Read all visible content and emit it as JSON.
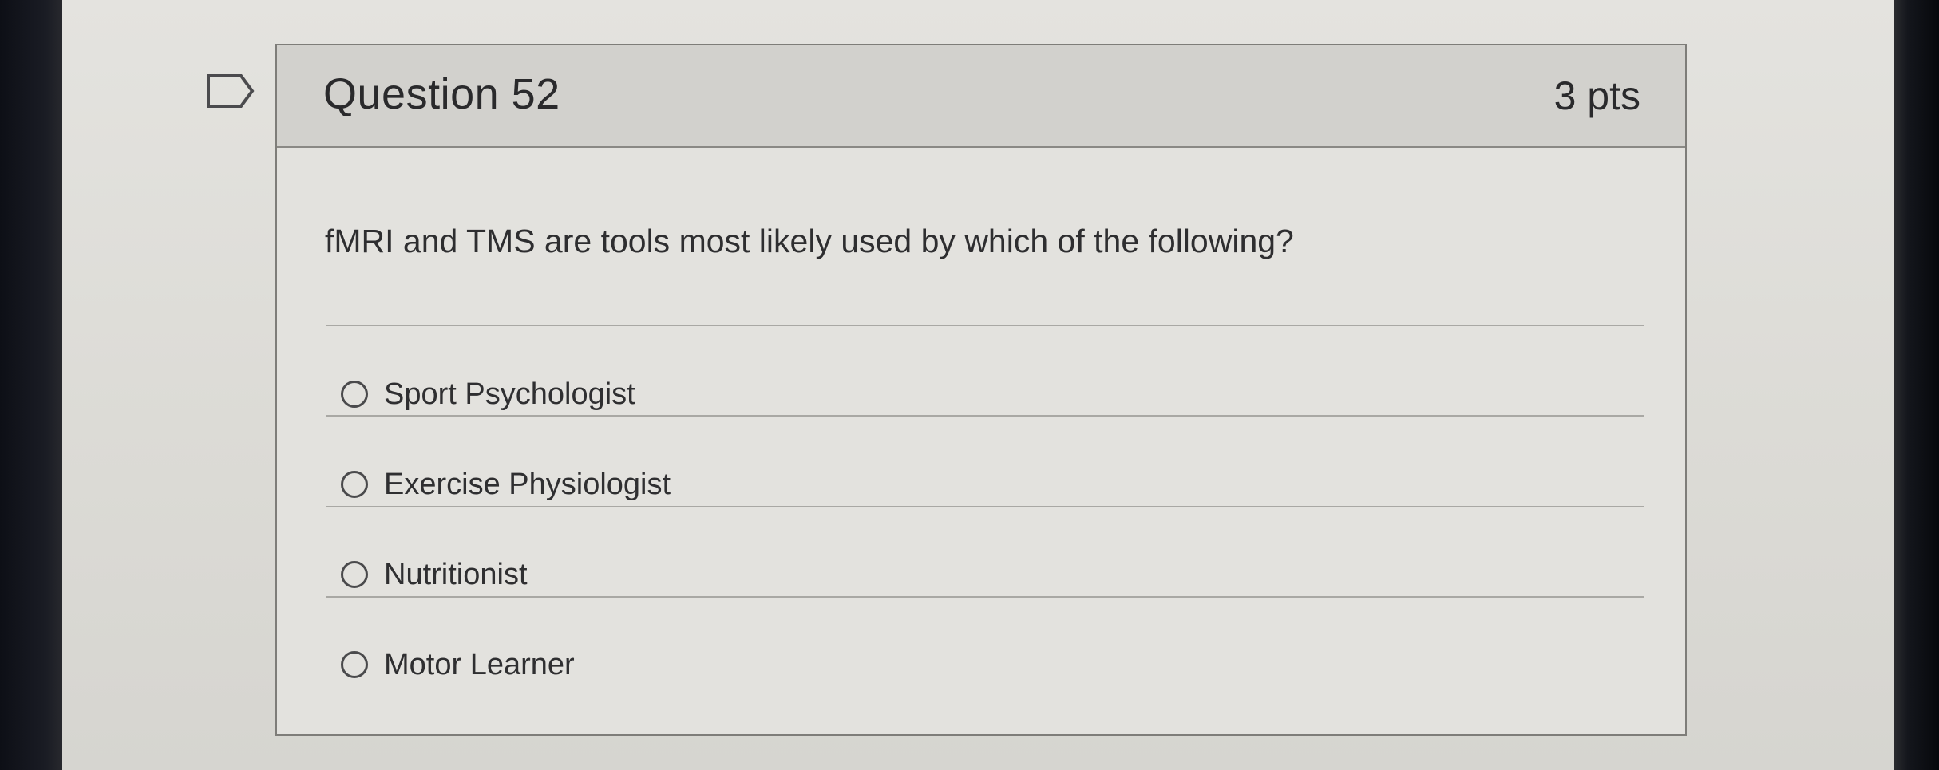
{
  "question": {
    "title": "Question 52",
    "points": "3 pts",
    "text": "fMRI and TMS are tools most likely used by which of the following?",
    "flag_icon": "flag-outline-icon",
    "answers": [
      {
        "label": "Sport Psychologist",
        "selected": false
      },
      {
        "label": "Exercise Physiologist",
        "selected": false
      },
      {
        "label": "Nutritionist",
        "selected": false
      },
      {
        "label": "Motor Learner",
        "selected": false
      }
    ]
  },
  "colors": {
    "background": "#dcdbd6",
    "header": "#d2d1cd",
    "border": "#7e7d79",
    "text": "#2a2a2c"
  }
}
